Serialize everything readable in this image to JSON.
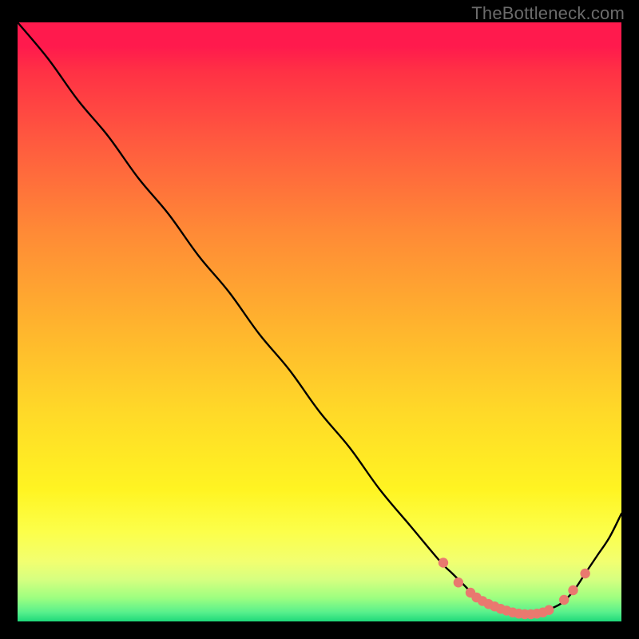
{
  "watermark": "TheBottleneck.com",
  "colors": {
    "background": "#000000",
    "curve_stroke": "#000000",
    "marker_fill": "#e9796f",
    "marker_stroke": "#d85a52",
    "watermark_text": "#6b6b6b"
  },
  "chart_data": {
    "type": "line",
    "title": "",
    "xlabel": "",
    "ylabel": "",
    "xlim": [
      0,
      100
    ],
    "ylim": [
      0,
      100
    ],
    "grid": false,
    "legend": null,
    "annotations": [],
    "series": [
      {
        "name": "curve",
        "x": [
          0,
          5,
          10,
          15,
          20,
          25,
          30,
          35,
          40,
          45,
          50,
          55,
          60,
          65,
          70,
          72,
          74,
          76,
          78,
          80,
          82,
          84,
          86,
          88,
          90,
          92,
          94,
          96,
          98,
          100
        ],
        "y": [
          100,
          94,
          87,
          81,
          74,
          68,
          61,
          55,
          48,
          42,
          35,
          29,
          22,
          16,
          10,
          8,
          6,
          4,
          3,
          2,
          1,
          1,
          1,
          2,
          3,
          5,
          8,
          11,
          14,
          18
        ]
      }
    ],
    "markers": {
      "name": "highlight-points",
      "x": [
        70.5,
        73,
        75,
        76,
        77,
        78,
        79,
        80,
        81,
        82,
        83,
        84,
        85,
        86,
        87,
        88,
        90.5,
        92,
        94
      ],
      "y": [
        9.8,
        6.5,
        4.8,
        4.0,
        3.4,
        2.9,
        2.5,
        2.1,
        1.8,
        1.5,
        1.3,
        1.2,
        1.2,
        1.3,
        1.5,
        1.9,
        3.6,
        5.2,
        8.0
      ]
    }
  }
}
